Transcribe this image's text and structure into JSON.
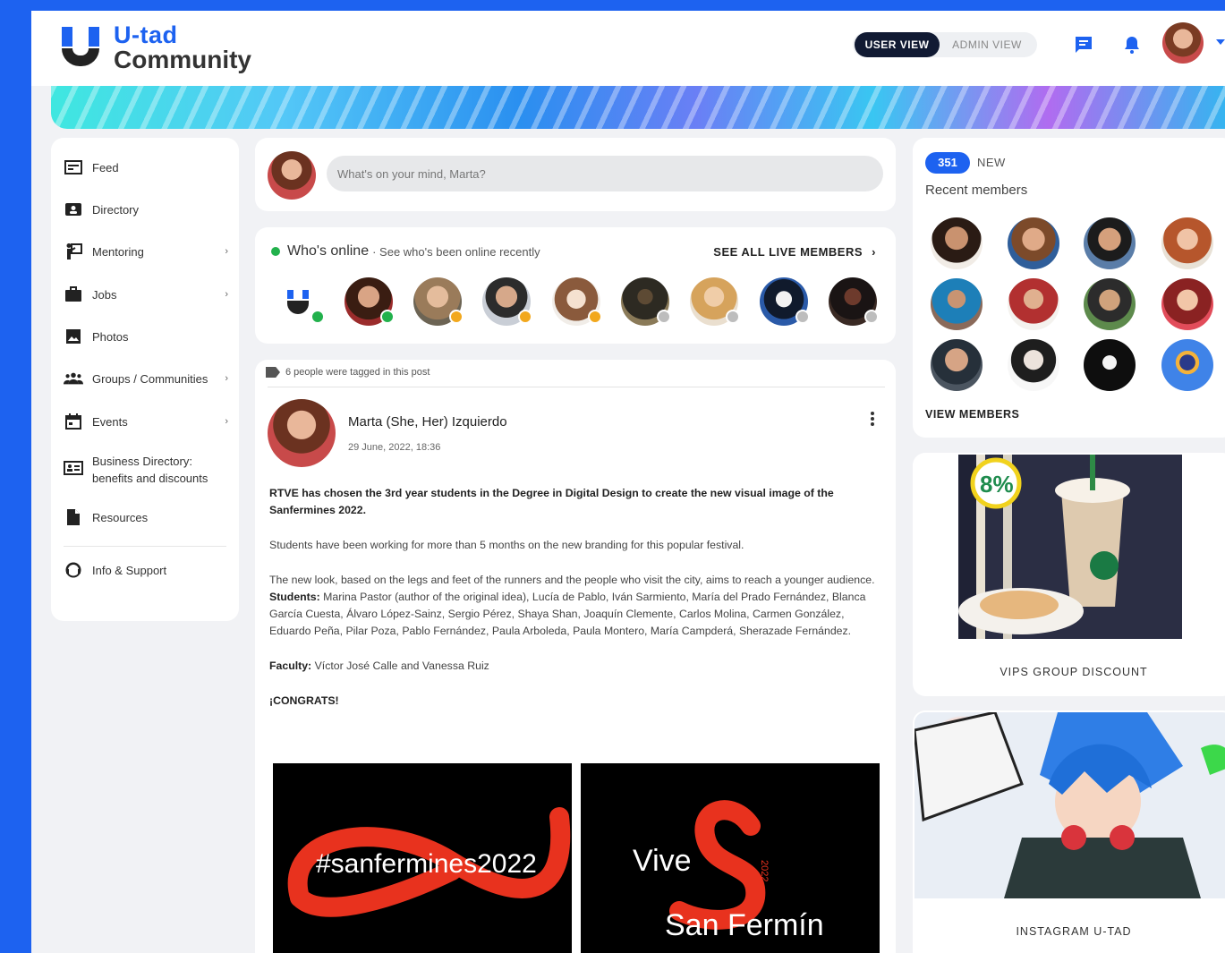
{
  "brand": {
    "name_line1": "U-tad",
    "name_line2": "Community"
  },
  "header": {
    "user_view": "USER VIEW",
    "admin_view": "ADMIN VIEW",
    "accent": "#1d62f0"
  },
  "sidebar": {
    "items": [
      {
        "label": "Feed",
        "icon": "feed-icon",
        "chevron": false
      },
      {
        "label": "Directory",
        "icon": "directory-icon",
        "chevron": false
      },
      {
        "label": "Mentoring",
        "icon": "mentoring-icon",
        "chevron": true
      },
      {
        "label": "Jobs",
        "icon": "briefcase-icon",
        "chevron": true
      },
      {
        "label": "Photos",
        "icon": "photo-icon",
        "chevron": false
      },
      {
        "label": "Groups / Communities",
        "icon": "groups-icon",
        "chevron": true
      },
      {
        "label": "Events",
        "icon": "calendar-icon",
        "chevron": true
      },
      {
        "label": "Business Directory:",
        "label2": "benefits and discounts",
        "icon": "business-card-icon",
        "chevron": false
      },
      {
        "label": "Resources",
        "icon": "document-icon",
        "chevron": false
      },
      {
        "label": "Info & Support",
        "icon": "support-icon",
        "chevron": false
      }
    ],
    "chevron_glyph": "›"
  },
  "composer": {
    "placeholder": "What's on your mind, Marta?"
  },
  "online": {
    "title": "Who's online",
    "subtitle": "· See who's been online recently",
    "see_all": "SEE ALL LIVE MEMBERS",
    "members": [
      {
        "status": "online"
      },
      {
        "status": "online"
      },
      {
        "status": "away"
      },
      {
        "status": "away"
      },
      {
        "status": "away"
      },
      {
        "status": "offline"
      },
      {
        "status": "offline"
      },
      {
        "status": "offline"
      },
      {
        "status": "offline"
      }
    ]
  },
  "post": {
    "tagged": "6 people were tagged in this post",
    "author": "Marta (She, Her) Izquierdo",
    "date": "29 June, 2022, 18:36",
    "paragraph1": "RTVE has chosen the 3rd year students in the Degree in Digital Design to create the new visual image of the Sanfermines 2022.",
    "paragraph2": "Students have been working for more than 5 months on the new branding for this popular festival.",
    "paragraph3": "The new look, based on the legs and feet of the runners and the people who visit the city, aims to reach a younger audience.",
    "students_label": "Students:",
    "students": "Marina Pastor (author of the original idea), Lucía de Pablo, Iván Sarmiento, María del Prado Fernández, Blanca García Cuesta, Álvaro López-Sainz, Sergio Pérez, Shaya Shan, Joaquín Clemente, Carlos Molina, Carmen González, Eduardo Peña, Pilar Poza, Pablo Fernández, Paula Arboleda, Paula Montero, María Campderá, Sherazade Fernández.",
    "faculty_label": "Faculty:",
    "faculty": "Víctor José Calle and Vanessa Ruiz",
    "congrats": "¡CONGRATS!",
    "image1_text": "#sanfermines2022",
    "image2_text1": "Vive",
    "image2_text2": "San Fermín",
    "image_year": "2022"
  },
  "recent": {
    "count": "351",
    "new_label": "NEW",
    "title": "Recent members",
    "view_members": "VIEW MEMBERS"
  },
  "promo": {
    "caption": "VIPS GROUP DISCOUNT",
    "badge": "8%"
  },
  "instagram": {
    "caption": "INSTAGRAM U-TAD"
  }
}
